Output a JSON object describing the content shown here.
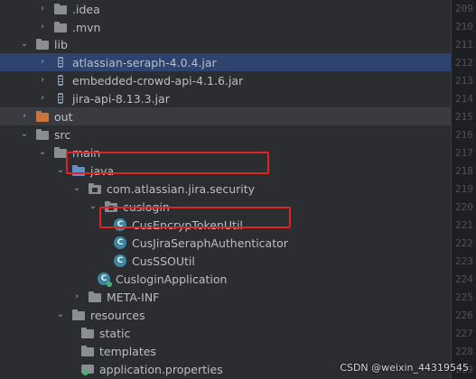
{
  "tree": [
    {
      "label": ".idea",
      "icon": "folder-icon",
      "expanded": false
    },
    {
      "label": ".mvn",
      "icon": "folder-icon",
      "expanded": false
    },
    {
      "label": "lib",
      "icon": "folder-icon",
      "expanded": true
    },
    {
      "label": "atlassian-seraph-4.0.4.jar",
      "icon": "jar-icon",
      "expanded": false
    },
    {
      "label": "embedded-crowd-api-4.1.6.jar",
      "icon": "jar-icon",
      "expanded": false
    },
    {
      "label": "jira-api-8.13.3.jar",
      "icon": "jar-icon",
      "expanded": false
    },
    {
      "label": "out",
      "icon": "folder-icon",
      "expanded": false
    },
    {
      "label": "src",
      "icon": "folder-icon",
      "expanded": true
    },
    {
      "label": "main",
      "icon": "folder-icon",
      "expanded": true
    },
    {
      "label": "java",
      "icon": "source-folder-icon",
      "expanded": true
    },
    {
      "label": "com.atlassian.jira.security",
      "icon": "package-icon",
      "expanded": true
    },
    {
      "label": "cuslogin",
      "icon": "package-icon",
      "expanded": true
    },
    {
      "label": "CusEncrypTokenUtil",
      "icon": "class-icon"
    },
    {
      "label": "CusJiraSeraphAuthenticator",
      "icon": "class-icon"
    },
    {
      "label": "CusSSOUtil",
      "icon": "class-icon"
    },
    {
      "label": "CusloginApplication",
      "icon": "spring-class-icon"
    },
    {
      "label": "META-INF",
      "icon": "folder-icon",
      "expanded": false
    },
    {
      "label": "resources",
      "icon": "resources-folder-icon",
      "expanded": true
    },
    {
      "label": "static",
      "icon": "folder-icon"
    },
    {
      "label": "templates",
      "icon": "folder-icon"
    },
    {
      "label": "application.properties",
      "icon": "properties-icon"
    }
  ],
  "gutter": [
    "209",
    "210",
    "211",
    "212",
    "213",
    "214",
    "215",
    "216",
    "217",
    "218",
    "219",
    "220",
    "221",
    "222",
    "223",
    "224",
    "225",
    "226",
    "227",
    "228",
    "229"
  ],
  "class_icon_letter": "C",
  "watermark": "CSDN @weixin_44319545",
  "colors": {
    "background": "#2b2d30",
    "selection": "#2e436e",
    "highlight_box": "#e02424",
    "class_icon": "#3e86a0",
    "excluded_folder": "#c77538"
  }
}
